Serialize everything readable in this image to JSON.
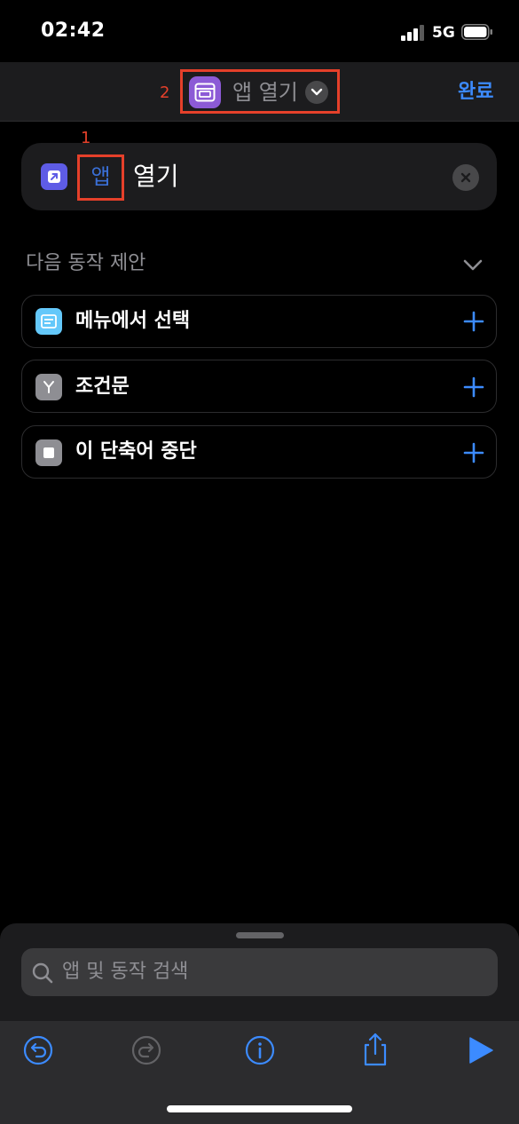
{
  "status": {
    "time": "02:42",
    "network": "5G"
  },
  "nav": {
    "marker": "2",
    "title": "앱 열기",
    "done_label": "완료"
  },
  "action": {
    "marker": "1",
    "app_token": "앱",
    "verb": "열기"
  },
  "suggestions": {
    "header": "다음 동작 제안",
    "items": [
      {
        "label": "메뉴에서 선택",
        "icon": "menu-icon",
        "color": "#64c8fa"
      },
      {
        "label": "조건문",
        "icon": "branch-icon",
        "color": "#8e8e93"
      },
      {
        "label": "이 단축어 중단",
        "icon": "stop-icon",
        "color": "#8e8e93"
      }
    ]
  },
  "search": {
    "placeholder": "앱 및 동작 검색"
  },
  "colors": {
    "accent": "#3c8bff",
    "highlight": "#e5402a",
    "app_icon": "#8c5ad6",
    "action_icon": "#5e5ce6"
  }
}
